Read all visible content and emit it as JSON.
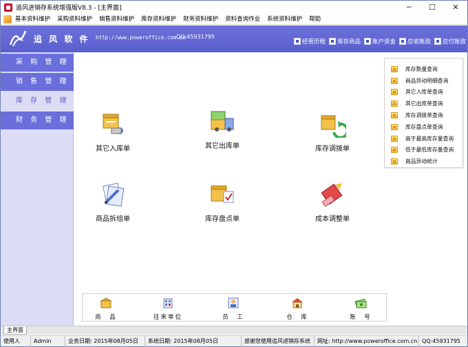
{
  "window": {
    "title": "追风进销存系统增强版V8.3 - [主界面]",
    "controls": {
      "minimize": "─",
      "maximize": "☐",
      "close": "✕"
    }
  },
  "menubar": {
    "items": [
      "基本资料维护",
      "采购资料维护",
      "销售资料维护",
      "库存资料维护",
      "财务资料维护",
      "资料查询作业",
      "系统资料维护",
      "帮助"
    ]
  },
  "header": {
    "logo_text": "追 风 软 件",
    "url": "http://www.poweroffice.com.cn",
    "qq": "QQ:45931795",
    "links": [
      "经营历程",
      "库存商品",
      "账户资金",
      "应收账款",
      "应付账款"
    ]
  },
  "sidebar": {
    "items": [
      {
        "label": "采 购 管 理",
        "active": false
      },
      {
        "label": "销 售 管 理",
        "active": false
      },
      {
        "label": "库 存 管 理",
        "active": true
      },
      {
        "label": "财 务 管 理",
        "active": false
      }
    ]
  },
  "main": {
    "tiles": [
      {
        "label": "其它入库单",
        "icon": "stock-in-icon"
      },
      {
        "label": "其它出库单",
        "icon": "stock-out-icon"
      },
      {
        "label": "库存调拨单",
        "icon": "transfer-icon"
      },
      {
        "label": "商品拆组单",
        "icon": "assembly-icon"
      },
      {
        "label": "库存盘点单",
        "icon": "inventory-check-icon"
      },
      {
        "label": "成本调整单",
        "icon": "cost-adjust-icon"
      }
    ]
  },
  "query_panel": {
    "items": [
      "库存数量查询",
      "商品异动明细查询",
      "其它入库单查询",
      "其它出库单查询",
      "库存调拨单查询",
      "库存盘点单查询",
      "高于最高库存量查询",
      "低于最低库存量查询",
      "商品异动统计"
    ]
  },
  "toolbar": {
    "items": [
      {
        "label": "商　品",
        "icon": "goods-box-icon"
      },
      {
        "label": "往来单位",
        "icon": "company-icon"
      },
      {
        "label": "员　工",
        "icon": "employee-icon"
      },
      {
        "label": "仓　库",
        "icon": "warehouse-icon"
      },
      {
        "label": "账　号",
        "icon": "money-icon"
      }
    ]
  },
  "tabs": {
    "main_tab": "主界面"
  },
  "statusbar": {
    "user_label": "使用人",
    "user": "Admin",
    "business_date": "业务日期: 2015年08月05日",
    "system_date": "系统日期: 2015年08月05日",
    "thanks": "感谢您使用追风进销存系统",
    "website": "网址: http://www.poweroffice.com.cn",
    "qq": "QQ:45931795"
  }
}
